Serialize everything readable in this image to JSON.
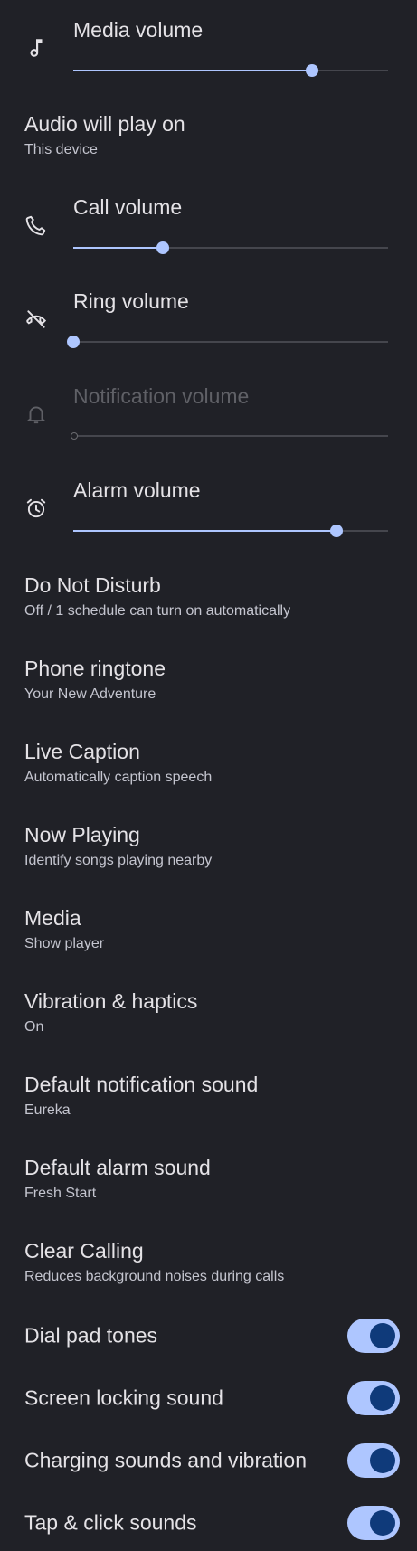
{
  "sliders": [
    {
      "label": "Media volume",
      "icon": "music-note-icon",
      "level": 0.76,
      "disabled": false
    },
    {
      "label": "Call volume",
      "icon": "phone-icon",
      "level": 0.285,
      "disabled": false
    },
    {
      "label": "Ring volume",
      "icon": "ring-muted-icon",
      "level": 0.0,
      "disabled": false
    },
    {
      "label": "Notification volume",
      "icon": "bell-icon",
      "level": 0.0,
      "disabled": true
    },
    {
      "label": "Alarm volume",
      "icon": "alarm-icon",
      "level": 0.835,
      "disabled": false
    }
  ],
  "audio_output": {
    "title": "Audio will play on",
    "summary": "This device"
  },
  "prefs": [
    {
      "title": "Do Not Disturb",
      "summary": "Off / 1 schedule can turn on automatically"
    },
    {
      "title": "Phone ringtone",
      "summary": "Your New Adventure"
    },
    {
      "title": "Live Caption",
      "summary": "Automatically caption speech"
    },
    {
      "title": "Now Playing",
      "summary": "Identify songs playing nearby"
    },
    {
      "title": "Media",
      "summary": "Show player"
    },
    {
      "title": "Vibration & haptics",
      "summary": "On"
    },
    {
      "title": "Default notification sound",
      "summary": "Eureka"
    },
    {
      "title": "Default alarm sound",
      "summary": "Fresh Start"
    },
    {
      "title": "Clear Calling",
      "summary": "Reduces background noises during calls"
    }
  ],
  "toggles": [
    {
      "title": "Dial pad tones",
      "on": true
    },
    {
      "title": "Screen locking sound",
      "on": true
    },
    {
      "title": "Charging sounds and vibration",
      "on": true
    },
    {
      "title": "Tap & click sounds",
      "on": true
    }
  ],
  "colors": {
    "background": "#202127",
    "accent": "#aec6ff",
    "switch_knob": "#0f3a7a",
    "track": "#45464d",
    "text_primary": "#e4e2e6",
    "text_secondary": "#c4c5cf",
    "text_disabled": "#5f6066"
  }
}
